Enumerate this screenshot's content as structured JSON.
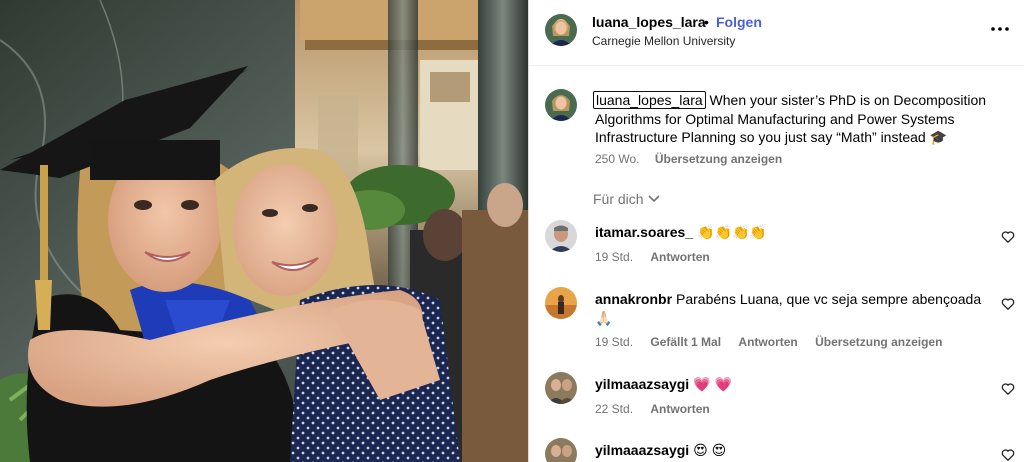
{
  "post": {
    "username": "luana_lopes_lara",
    "follow_label": "Folgen",
    "separator": "•",
    "subtitle": "Carnegie Mellon University",
    "caption_username": "luana_lopes_lara",
    "caption_text": "When your sister’s PhD is on Decomposition Algorithms for Optimal Manufacturing and Power Systems Infrastructure Planning so you just say “Math” instead 🎓",
    "caption_age": "250 Wo.",
    "translate_label": "Übersetzung anzeigen"
  },
  "sort_label": "Für dich",
  "comments": [
    {
      "user": "itamar.soares_",
      "text": "👏👏👏👏",
      "age": "19 Std.",
      "likes": "",
      "reply": "Antworten",
      "translate": ""
    },
    {
      "user": "annakronbr",
      "text": "Parabéns Luana, que vc seja sempre abençoada 🙏🏻",
      "age": "19 Std.",
      "likes": "Gefällt 1 Mal",
      "reply": "Antworten",
      "translate": "Übersetzung anzeigen"
    },
    {
      "user": "yilmaaazsaygi",
      "text": "💗 💗",
      "age": "22 Std.",
      "likes": "",
      "reply": "Antworten",
      "translate": ""
    },
    {
      "user": "yilmaaazsaygi",
      "text": "😍 😍",
      "age": "",
      "likes": "",
      "reply": "",
      "translate": ""
    }
  ],
  "icons": {
    "more": "more-options-icon",
    "chevron": "chevron-down-icon",
    "heart": "heart-outline-icon"
  },
  "colors": {
    "follow": "#4c5fd5",
    "meta": "#737373",
    "divider": "#efefef"
  }
}
